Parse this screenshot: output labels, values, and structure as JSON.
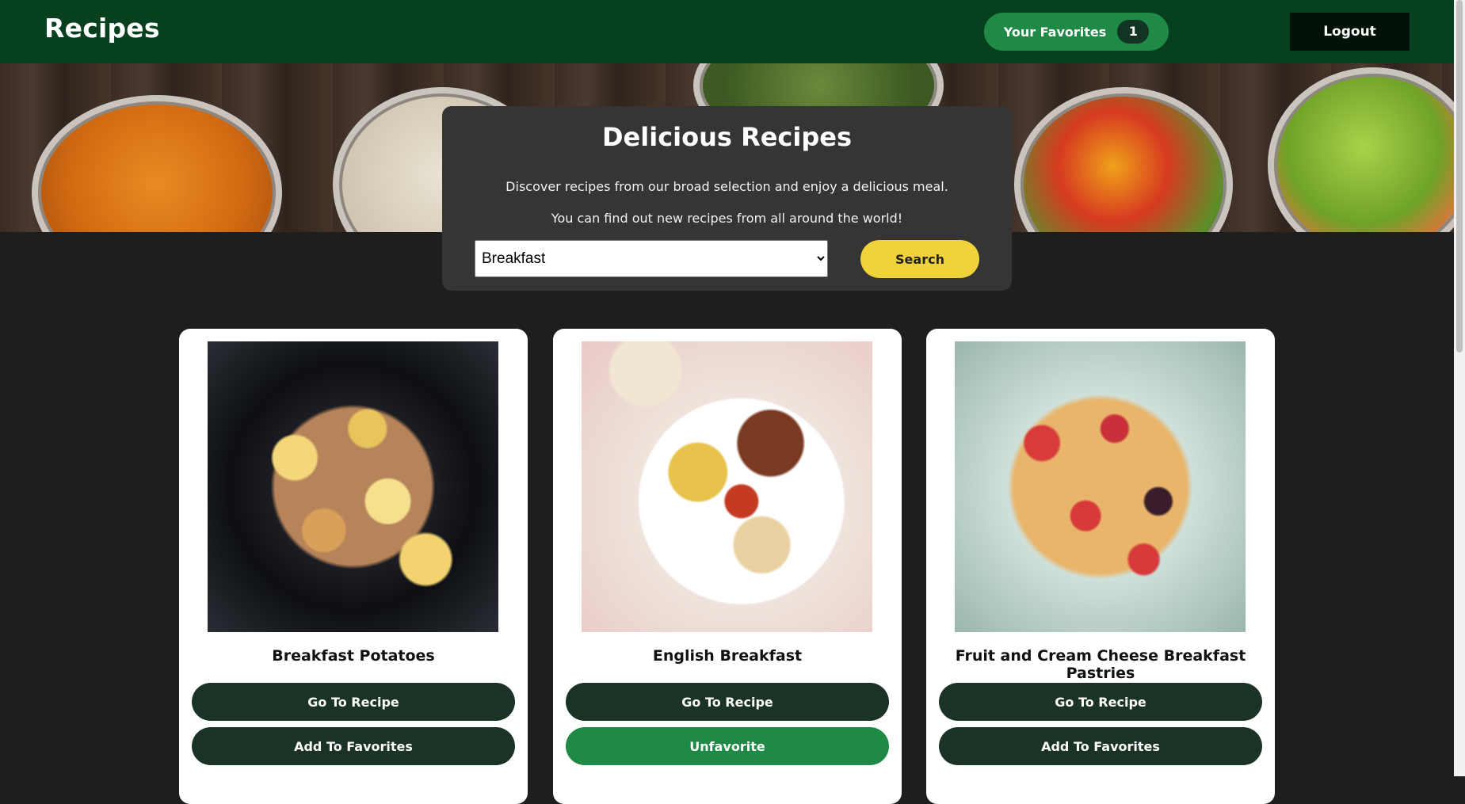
{
  "navbar": {
    "brand": "Recipes",
    "favorites_label": "Your Favorites",
    "favorites_count": "1",
    "logout_label": "Logout"
  },
  "hero": {
    "title": "Delicious Recipes",
    "line1": "Discover recipes from our broad selection and enjoy a delicious meal.",
    "line2": "You can find out new recipes from all around the world!",
    "category_selected": "Breakfast",
    "search_label": "Search"
  },
  "recipes": [
    {
      "title": "Breakfast Potatoes",
      "go_label": "Go To Recipe",
      "fav_label": "Add To Favorites",
      "image": "breakfast-potatoes-image"
    },
    {
      "title": "English Breakfast",
      "go_label": "Go To Recipe",
      "fav_label": "Unfavorite",
      "image": "english-breakfast-image"
    },
    {
      "title": "Fruit and Cream Cheese Breakfast Pastries",
      "go_label": "Go To Recipe",
      "fav_label": "Add To Favorites",
      "image": "pastries-image"
    }
  ],
  "colors": {
    "navbar": "#06401f",
    "favorites_button": "#1f8a45",
    "dark_button": "#1a3324",
    "search_button": "#f0d33a",
    "background": "#1e1e1e",
    "hero_card": "#353535"
  }
}
